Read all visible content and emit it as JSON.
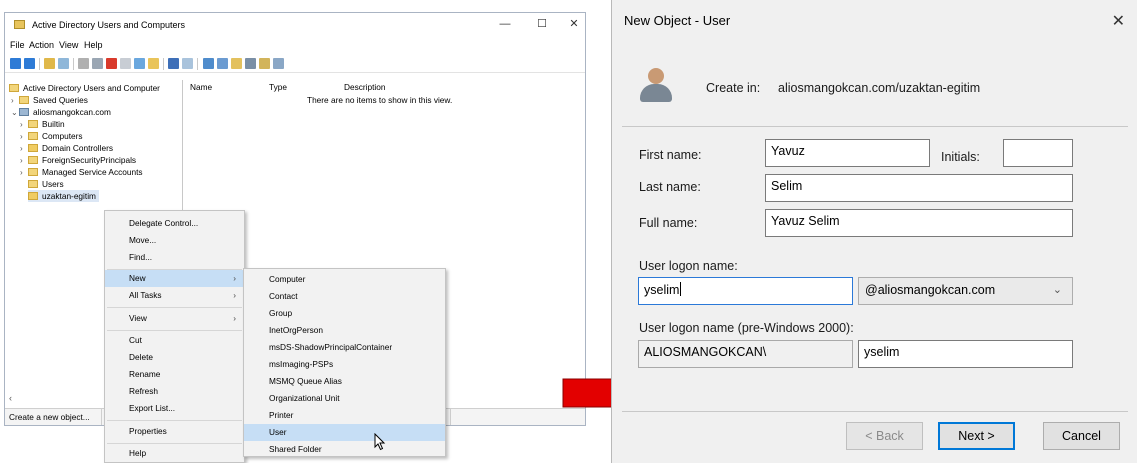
{
  "aduc": {
    "title": "Active Directory Users and Computers",
    "window_controls": {
      "minimize": "—",
      "maximize": "☐",
      "close": "✕"
    },
    "menu": [
      "File",
      "Action",
      "View",
      "Help"
    ],
    "tree": {
      "root": "Active Directory Users and Computer",
      "saved_queries": "Saved Queries",
      "domain": "aliosmangokcan.com",
      "items": [
        "Builtin",
        "Computers",
        "Domain Controllers",
        "ForeignSecurityPrincipals",
        "Managed Service Accounts",
        "Users",
        "uzaktan-egitim"
      ]
    },
    "columns": [
      "Name",
      "Type",
      "Description"
    ],
    "empty_message": "There are no items to show in this view.",
    "status": "Create a new object..."
  },
  "context_menu": {
    "delegate": "Delegate Control...",
    "move": "Move...",
    "find": "Find...",
    "new": "New",
    "all_tasks": "All Tasks",
    "view": "View",
    "cut": "Cut",
    "delete": "Delete",
    "rename": "Rename",
    "refresh": "Refresh",
    "export": "Export List...",
    "properties": "Properties",
    "help": "Help"
  },
  "new_submenu": {
    "items": [
      "Computer",
      "Contact",
      "Group",
      "InetOrgPerson",
      "msDS-ShadowPrincipalContainer",
      "msImaging-PSPs",
      "MSMQ Queue Alias",
      "Organizational Unit",
      "Printer",
      "User",
      "Shared Folder"
    ]
  },
  "dialog": {
    "title": "New Object - User",
    "close": "✕",
    "create_in_label": "Create in:",
    "create_in_value": "aliosmangokcan.com/uzaktan-egitim",
    "first_name_label": "First name:",
    "first_name": "Yavuz",
    "initials_label": "Initials:",
    "initials": "",
    "last_name_label": "Last name:",
    "last_name": "Selim",
    "full_name_label": "Full name:",
    "full_name": "Yavuz Selim",
    "logon_label": "User logon name:",
    "logon_name": "yselim",
    "domain_suffix": "@aliosmangokcan.com",
    "pre2000_label": "User logon name (pre-Windows 2000):",
    "pre2000_domain": "ALIOSMANGOKCAN\\",
    "pre2000_name": "yselim",
    "back": "< Back",
    "next": "Next >",
    "cancel": "Cancel"
  },
  "colors": {
    "arrow": "#e30000",
    "highlight": "#c6def5",
    "focus": "#0078d7"
  }
}
